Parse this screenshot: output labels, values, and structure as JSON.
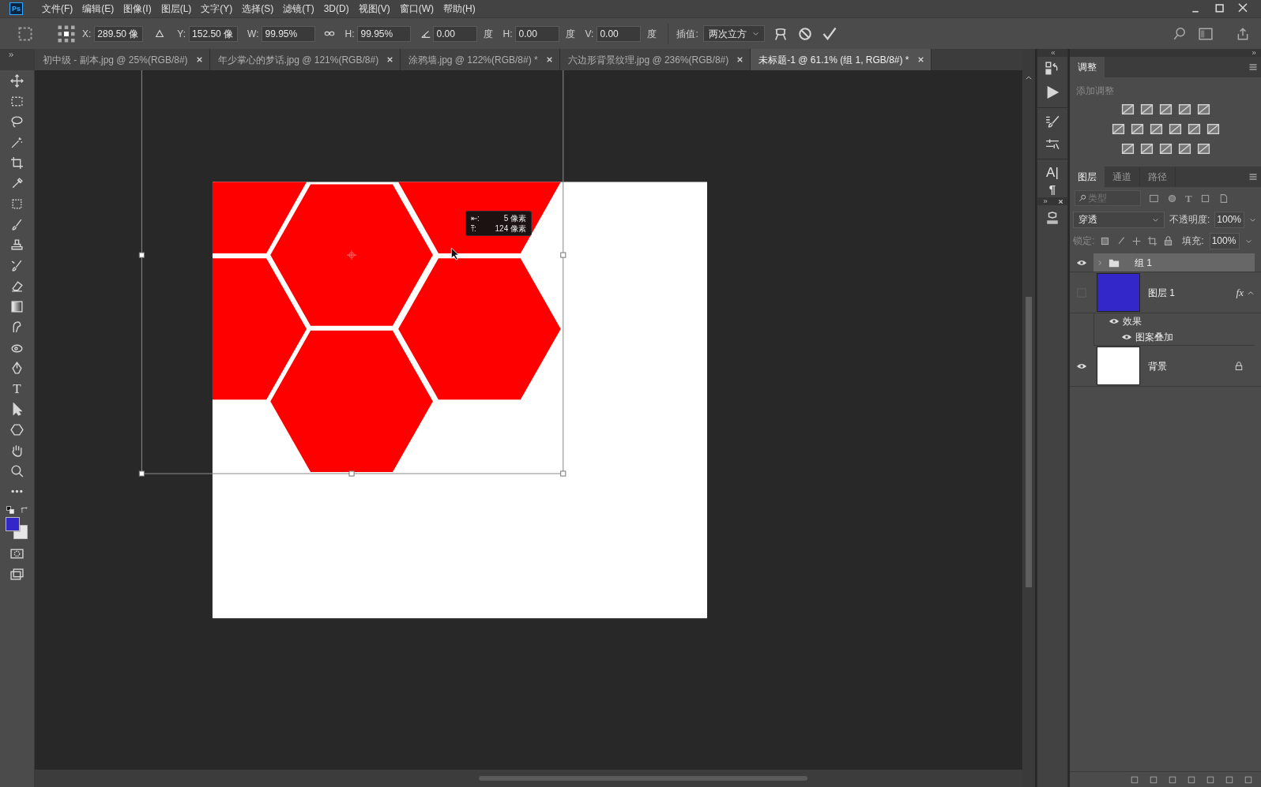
{
  "app": {
    "logo": "Ps"
  },
  "menu": [
    "文件(F)",
    "编辑(E)",
    "图像(I)",
    "图层(L)",
    "文字(Y)",
    "选择(S)",
    "滤镜(T)",
    "3D(D)",
    "视图(V)",
    "窗口(W)",
    "帮助(H)"
  ],
  "options": {
    "fields": [
      {
        "kind": "pos",
        "label": "X:",
        "value": "289.50 像"
      },
      {
        "kind": "pos",
        "label": "Y:",
        "value": "152.50 像"
      },
      {
        "kind": "scale",
        "label": "W:",
        "value": "99.95%"
      },
      {
        "kind": "scale",
        "label": "H:",
        "value": "99.95%"
      },
      {
        "kind": "angle",
        "value": "0.00",
        "unit": "度"
      },
      {
        "kind": "skew",
        "label": "H:",
        "value": "0.00",
        "unit": "度"
      },
      {
        "kind": "skew",
        "label": "V:",
        "value": "0.00",
        "unit": "度"
      }
    ],
    "interpolation_label": "插值:",
    "interpolation": "两次立方"
  },
  "tabs": [
    {
      "label": "初中级 - 副本.jpg @ 25%(RGB/8#)",
      "selected": false
    },
    {
      "label": "年少掌心的梦话.jpg @ 121%(RGB/8#)",
      "selected": false
    },
    {
      "label": "涂鸦墙.jpg @ 122%(RGB/8#) *",
      "selected": false
    },
    {
      "label": "六边形背景纹理.jpg @ 236%(RGB/8#)",
      "selected": false
    },
    {
      "label": "未标题-1 @ 61.1% (组 1, RGB/8#) *",
      "selected": true
    }
  ],
  "toolbar": {
    "type_glyph": "T",
    "swatches": [
      {
        "kind": "foreground",
        "color": "#3327c9"
      },
      {
        "kind": "background",
        "color": "#e6e6e6"
      }
    ]
  },
  "tooltip": {
    "lines": [
      {
        "symbol": "⇤:",
        "value": "5 像素"
      },
      {
        "symbol": "⤒:",
        "value": "124 像素"
      }
    ]
  },
  "dock": {
    "glyphs": [
      "A|",
      "¶"
    ]
  },
  "adjustments": {
    "tabs": [
      {
        "label": "调整",
        "selected": true
      }
    ],
    "hint": "添加调整"
  },
  "layers_panel": {
    "tabs": [
      {
        "label": "图层",
        "selected": true
      },
      {
        "label": "通道",
        "selected": false
      },
      {
        "label": "路径",
        "selected": false
      }
    ],
    "filter": {
      "placeholder": "类型",
      "type_glyph": "T"
    },
    "blend_mode": "穿透",
    "opacity_label": "不透明度:",
    "opacity": "100%",
    "lock_label": "锁定:",
    "fill_label": "填充:",
    "fill": "100%",
    "layers": [
      {
        "kind": "group",
        "name": "组 1",
        "visible": true,
        "selected": true,
        "expanded": false
      },
      {
        "kind": "layer",
        "name": "图层 1",
        "visible": false,
        "selected": false,
        "expanded": true,
        "color": "#3327c9",
        "fx": "fx",
        "locked": false,
        "children": [
          {
            "name": "效果",
            "visible": true,
            "children": [
              {
                "name": "图案叠加",
                "visible": true
              }
            ]
          }
        ]
      },
      {
        "kind": "layer",
        "name": "背景",
        "visible": true,
        "selected": false,
        "color": "#ffffff",
        "locked": true
      }
    ]
  }
}
